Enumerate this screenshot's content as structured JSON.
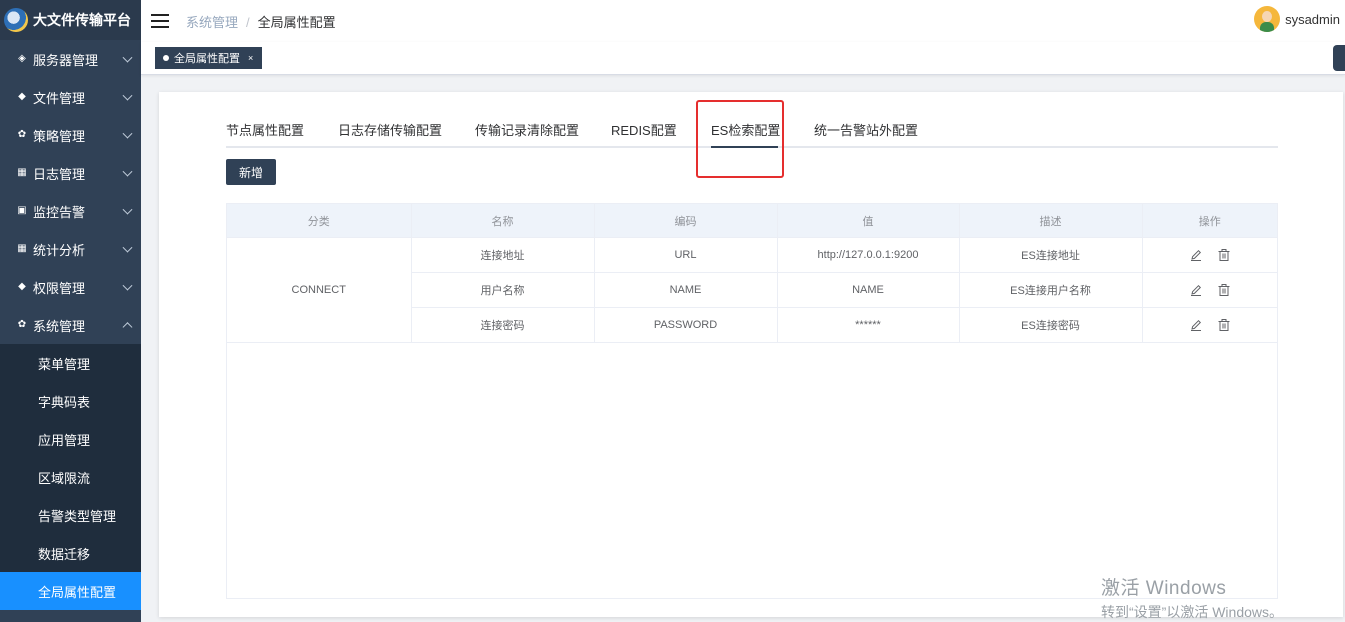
{
  "app": {
    "title": "大文件传输平台"
  },
  "sidebar": {
    "menus": [
      {
        "label": "服务器管理",
        "icon": "cube-icon"
      },
      {
        "label": "文件管理",
        "icon": "layers-icon"
      },
      {
        "label": "策略管理",
        "icon": "gear-icon"
      },
      {
        "label": "日志管理",
        "icon": "grid-icon"
      },
      {
        "label": "监控告警",
        "icon": "monitor-icon"
      },
      {
        "label": "统计分析",
        "icon": "chart-icon"
      },
      {
        "label": "权限管理",
        "icon": "layers-icon"
      },
      {
        "label": "系统管理",
        "icon": "gear-icon"
      }
    ],
    "submenu": [
      "菜单管理",
      "字典码表",
      "应用管理",
      "区域限流",
      "告警类型管理",
      "数据迁移",
      "全局属性配置"
    ]
  },
  "topbar": {
    "breadcrumb": [
      "系统管理",
      "全局属性配置"
    ],
    "separator": "/",
    "username": "sysadmin"
  },
  "tagsbar": {
    "tag_label": "全局属性配置",
    "close": "×"
  },
  "tabs": [
    "节点属性配置",
    "日志存储传输配置",
    "传输记录清除配置",
    "REDIS配置",
    "ES检索配置",
    "统一告警站外配置"
  ],
  "active_tab": "ES检索配置",
  "add_button": "新增",
  "table": {
    "headers": [
      "分类",
      "名称",
      "编码",
      "值",
      "描述",
      "操作"
    ],
    "category": "CONNECT",
    "rows": [
      {
        "name": "连接地址",
        "code": "URL",
        "value": "http://127.0.0.1:9200",
        "desc": "ES连接地址"
      },
      {
        "name": "用户名称",
        "code": "NAME",
        "value": "NAME",
        "desc": "ES连接用户名称"
      },
      {
        "name": "连接密码",
        "code": "PASSWORD",
        "value": "******",
        "desc": "ES连接密码"
      }
    ]
  },
  "watermark": {
    "line1": "激活 Windows",
    "line2": "转到“设置”以激活 Windows。"
  },
  "colors": {
    "sidebar": "#304156",
    "active": "#1890ff",
    "highlight": "#e52e2e"
  }
}
